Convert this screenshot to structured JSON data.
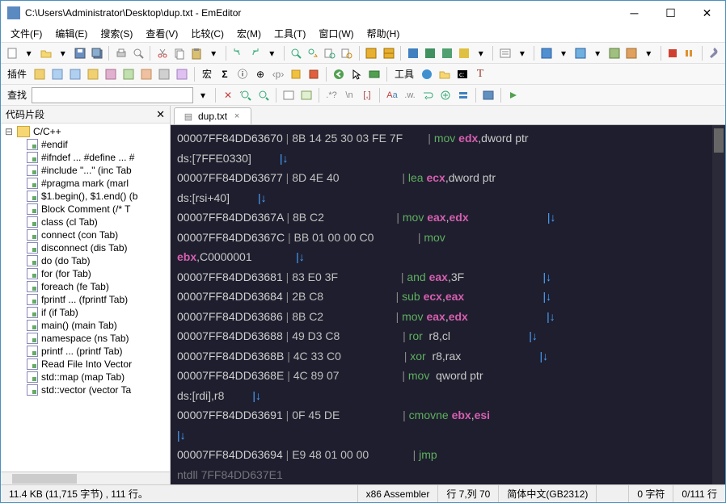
{
  "title": "C:\\Users\\Administrator\\Desktop\\dup.txt - EmEditor",
  "menu": [
    "文件(F)",
    "编辑(E)",
    "搜索(S)",
    "查看(V)",
    "比较(C)",
    "宏(M)",
    "工具(T)",
    "窗口(W)",
    "帮助(H)"
  ],
  "tb2": {
    "plugins": "插件",
    "macros": "宏",
    "sigma": "Σ",
    "tools": "工具"
  },
  "tb3": {
    "find": "查找"
  },
  "sidebar": {
    "title": "代码片段",
    "root": "C/C++",
    "items": [
      "#endif",
      "#ifndef ... #define ... #",
      "#include \"...\"  (inc Tab",
      "#pragma mark  (marl",
      "$1.begin(), $1.end()  (b",
      "Block Comment  (/* T",
      "class  (cl Tab)",
      "connect  (con Tab)",
      "disconnect  (dis Tab)",
      "do  (do Tab)",
      "for  (for Tab)",
      "foreach  (fe Tab)",
      "fprintf ...  (fprintf Tab)",
      "if  (if Tab)",
      "main()  (main Tab)",
      "namespace  (ns Tab)",
      "printf ...  (printf Tab)",
      "Read File Into Vector",
      "std::map  (map Tab)",
      "std::vector  (vector Ta"
    ]
  },
  "tab": {
    "name": "dup.txt"
  },
  "code": [
    {
      "addr": "00007FF84DD63670",
      "bytes": "8B 14 25 30 03 FE 7F",
      "mn": "mov",
      "ops": [
        {
          "t": "reg",
          "v": "edx"
        },
        {
          "t": "plain",
          "v": ",dword ptr"
        }
      ],
      "nl": ""
    },
    {
      "cont": "ds:[7FFE0330]",
      "arrow": "|↓"
    },
    {
      "addr": "00007FF84DD63677",
      "bytes": "8D 4E 40",
      "mn": "lea",
      "ops": [
        {
          "t": "reg",
          "v": "ecx"
        },
        {
          "t": "plain",
          "v": ",dword ptr"
        }
      ],
      "nl": ""
    },
    {
      "cont": "ds:[rsi+40]",
      "arrow": "|↓"
    },
    {
      "addr": "00007FF84DD6367A",
      "bytes": "8B C2",
      "mn": "mov",
      "ops": [
        {
          "t": "reg",
          "v": "eax"
        },
        {
          "t": "plain",
          "v": ","
        },
        {
          "t": "reg",
          "v": "edx"
        }
      ],
      "tail": "|↓"
    },
    {
      "addr": "00007FF84DD6367C",
      "bytes": "BB 01 00 00 C0",
      "mn": "mov",
      "ops": [],
      "nl": ""
    },
    {
      "contreg": "ebx",
      "contplain": ",C0000001",
      "arrow": "|↓"
    },
    {
      "addr": "00007FF84DD63681",
      "bytes": "83 E0 3F",
      "mn": "and",
      "ops": [
        {
          "t": "reg",
          "v": "eax"
        },
        {
          "t": "plain",
          "v": ",3F"
        }
      ],
      "tail": "|↓"
    },
    {
      "addr": "00007FF84DD63684",
      "bytes": "2B C8",
      "mn": "sub",
      "ops": [
        {
          "t": "reg",
          "v": "ecx"
        },
        {
          "t": "plain",
          "v": ","
        },
        {
          "t": "reg",
          "v": "eax"
        }
      ],
      "tail": "|↓"
    },
    {
      "addr": "00007FF84DD63686",
      "bytes": "8B C2",
      "mn": "mov",
      "ops": [
        {
          "t": "reg",
          "v": "eax"
        },
        {
          "t": "plain",
          "v": ","
        },
        {
          "t": "reg",
          "v": "edx"
        }
      ],
      "tail": "|↓"
    },
    {
      "addr": "00007FF84DD63688",
      "bytes": "49 D3 C8",
      "mn": "ror",
      "ops": [
        {
          "t": "plain",
          "v": " r8,cl"
        }
      ],
      "tail": "|↓"
    },
    {
      "addr": "00007FF84DD6368B",
      "bytes": "4C 33 C0",
      "mn": "xor",
      "ops": [
        {
          "t": "plain",
          "v": " r8,rax"
        }
      ],
      "tail": "|↓"
    },
    {
      "addr": "00007FF84DD6368E",
      "bytes": "4C 89 07",
      "mn": "mov",
      "ops": [
        {
          "t": "plain",
          "v": " qword ptr"
        }
      ],
      "nl": ""
    },
    {
      "cont": "ds:[rdi],r8",
      "arrow": "|↓"
    },
    {
      "addr": "00007FF84DD63691",
      "bytes": "0F 45 DE",
      "mn": "cmovne",
      "ops": [
        {
          "t": "reg",
          "v": "ebx"
        },
        {
          "t": "plain",
          "v": ","
        },
        {
          "t": "reg",
          "v": "esi"
        }
      ],
      "nl": ""
    },
    {
      "arrowonly": "|↓"
    },
    {
      "addr": "00007FF84DD63694",
      "bytes": "E9 48 01 00 00",
      "mn": "jmp",
      "ops": [],
      "nl": ""
    }
  ],
  "partial": "ntdll 7FF84DD637E1",
  "status": {
    "left": "11.4 KB (11,715 字节) , 111 行。",
    "lang": "x86 Assembler",
    "pos": "行 7,列 70",
    "enc": "简体中文(GB2312)",
    "sel": "0 字符",
    "lines": "0/111 行"
  }
}
